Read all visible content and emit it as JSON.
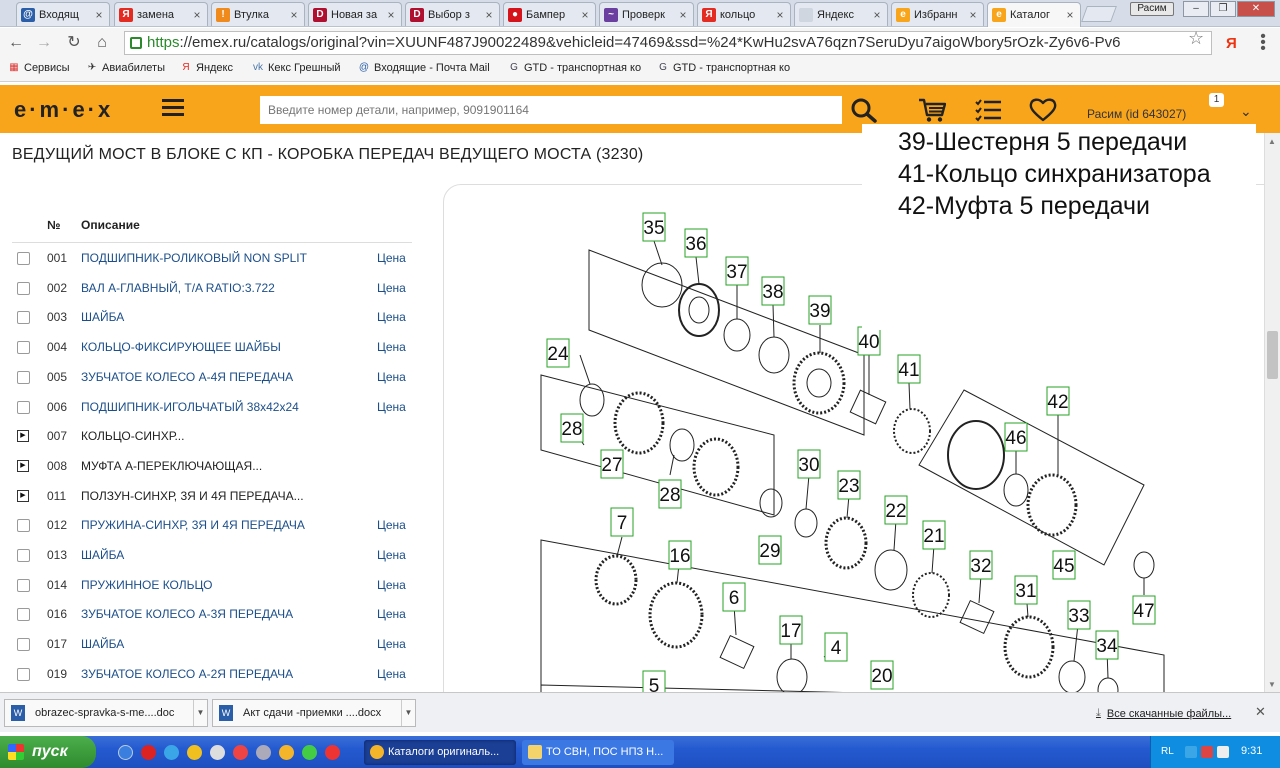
{
  "browser": {
    "tabs": [
      {
        "label": "Входящ",
        "color": "#2b5ea8",
        "glyph": "@"
      },
      {
        "label": "замена",
        "color": "#e32b22",
        "glyph": "Я"
      },
      {
        "label": "Втулка",
        "color": "#f08a1c",
        "glyph": "!"
      },
      {
        "label": "Новая за",
        "color": "#b0102f",
        "glyph": "D"
      },
      {
        "label": "Выбор з",
        "color": "#b0102f",
        "glyph": "D"
      },
      {
        "label": "Бампер",
        "color": "#d4141a",
        "glyph": "●"
      },
      {
        "label": "Проверк",
        "color": "#6a3fa0",
        "glyph": "~"
      },
      {
        "label": "кольцо",
        "color": "#e32b22",
        "glyph": "Я"
      },
      {
        "label": "Яндекс",
        "color": "#cfd6e0",
        "glyph": ""
      },
      {
        "label": "Избранн",
        "color": "#f9a51c",
        "glyph": "e"
      },
      {
        "label": "Каталог",
        "color": "#f9a51c",
        "glyph": "e"
      }
    ],
    "user_chip": "Расим",
    "url_scheme": "https",
    "url_rest": "://emex.ru/catalogs/original?vin=XUUNF487J90022489&vehicleid=47469&ssd=%24*KwHu2svA76qzn7SeruDyu7aigoWbory5rOzk-Zy6v6-Pv6",
    "bookmarks": [
      {
        "label": "Сервисы",
        "glyph": "▦",
        "color": "#d33"
      },
      {
        "label": "Авиабилеты",
        "glyph": "✈",
        "color": "#333"
      },
      {
        "label": "Яндекс",
        "glyph": "Я",
        "color": "#e32b22"
      },
      {
        "label": "Кекс Грешный",
        "glyph": "vk",
        "color": "#4a76a8"
      },
      {
        "label": "Входящие - Почта Mail",
        "glyph": "@",
        "color": "#2b5ea8"
      },
      {
        "label": "GTD - транспортная ко",
        "glyph": "G",
        "color": "#445"
      },
      {
        "label": "GTD - транспортная ко",
        "glyph": "G",
        "color": "#445"
      }
    ]
  },
  "site": {
    "logo": "e·m·e·x",
    "search_placeholder": "Введите номер детали, например, 9091901164",
    "user_name": "Расим",
    "user_id": "(id 643027)",
    "cart_badge": "1",
    "accent": "#f9a51c"
  },
  "page": {
    "title": "ВЕДУЩИЙ МОСТ В БЛОКЕ С КП - КОРОБКА ПЕРЕДАЧ ВЕДУЩЕГО МОСТА (3230)",
    "columns": {
      "num": "№",
      "desc": "Описание"
    },
    "price_label": "Цена",
    "rows": [
      {
        "num": "001",
        "desc": "ПОДШИПНИК-РОЛИКОВЫЙ NON SPLIT",
        "expandable": false
      },
      {
        "num": "002",
        "desc": "ВАЛ А-ГЛАВНЫЙ, T/A RATIO:3.722",
        "expandable": false
      },
      {
        "num": "003",
        "desc": "ШАЙБА",
        "expandable": false
      },
      {
        "num": "004",
        "desc": "КОЛЬЦО-ФИКСИРУЮЩЕЕ ШАЙБЫ",
        "expandable": false
      },
      {
        "num": "005",
        "desc": "ЗУБЧАТОЕ КОЛЕСО А-4Я ПЕРЕДАЧА",
        "expandable": false
      },
      {
        "num": "006",
        "desc": "ПОДШИПНИК-ИГОЛЬЧАТЫЙ 38x42x24",
        "expandable": false
      },
      {
        "num": "007",
        "desc": "КОЛЬЦО-СИНХР...",
        "expandable": true
      },
      {
        "num": "008",
        "desc": "МУФТА А-ПЕРЕКЛЮЧАЮЩАЯ...",
        "expandable": true
      },
      {
        "num": "011",
        "desc": "ПОЛЗУН-СИНХР, 3Я И 4Я ПЕРЕДАЧА...",
        "expandable": true
      },
      {
        "num": "012",
        "desc": "ПРУЖИНА-СИНХР, 3Я И 4Я ПЕРЕДАЧА",
        "expandable": false
      },
      {
        "num": "013",
        "desc": "ШАЙБА",
        "expandable": false
      },
      {
        "num": "014",
        "desc": "ПРУЖИННОЕ КОЛЬЦО",
        "expandable": false
      },
      {
        "num": "016",
        "desc": "ЗУБЧАТОЕ КОЛЕСО А-3Я ПЕРЕДАЧА",
        "expandable": false
      },
      {
        "num": "017",
        "desc": "ШАЙБА",
        "expandable": false
      },
      {
        "num": "019",
        "desc": "ЗУБЧАТОЕ КОЛЕСО А-2Я ПЕРЕДАЧА",
        "expandable": false
      }
    ],
    "diagram_callouts": [
      "35",
      "36",
      "37",
      "38",
      "39",
      "40",
      "41",
      "42",
      "24",
      "28",
      "27",
      "28",
      "46",
      "30",
      "23",
      "22",
      "21",
      "29",
      "45",
      "47",
      "7",
      "16",
      "6",
      "32",
      "31",
      "33",
      "34",
      "17",
      "4",
      "20",
      "5"
    ],
    "note_lines": [
      "39-Шестерня 5 передачи",
      "41-Кольцо синхранизатора",
      "42-Муфта 5 передачи"
    ]
  },
  "downloads": {
    "items": [
      "obrazec-spravka-s-me....doc",
      "Акт сдачи -приемки ....docx"
    ],
    "all_label": "Все скачанные файлы..."
  },
  "taskbar": {
    "start_label": "пуск",
    "tasks": [
      "Каталоги оригиналь...",
      "ТО СВН, ПОС НПЗ Н..."
    ],
    "lang": "RL",
    "clock": "9:31"
  }
}
